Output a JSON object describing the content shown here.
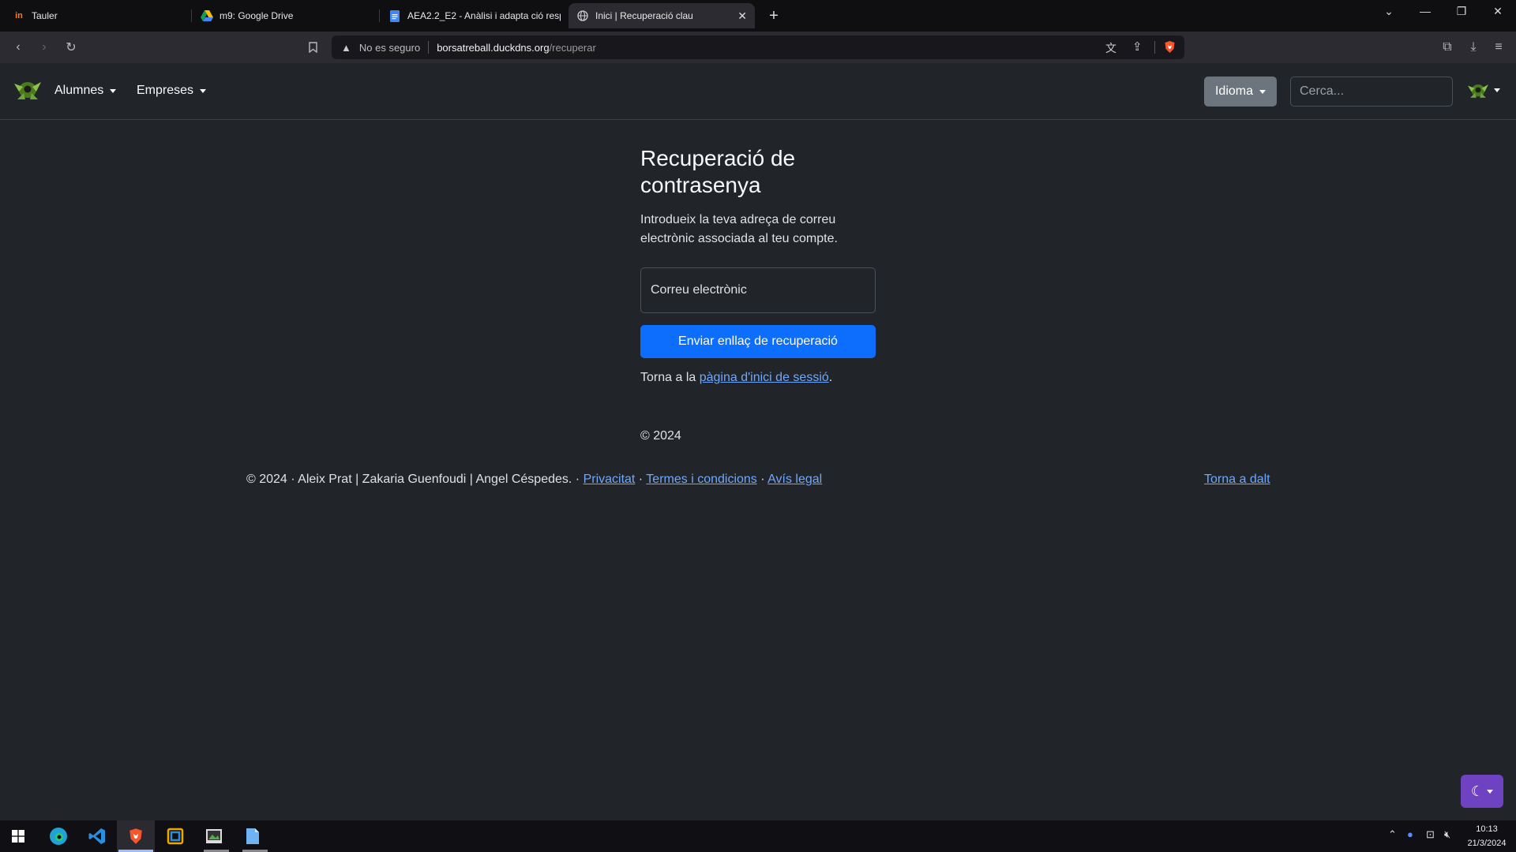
{
  "browser": {
    "tabs": [
      {
        "title": "Tauler",
        "favicon": "in"
      },
      {
        "title": "m9: Google Drive",
        "favicon": "drive"
      },
      {
        "title": "AEA2.2_E2 - Anàlisi i adapta ció resp",
        "favicon": "doc"
      },
      {
        "title": "Inici | Recuperació clau",
        "favicon": "globe",
        "active": true
      }
    ],
    "url_warning": "No es seguro",
    "url_host": "borsatreball.duckdns.org",
    "url_path": "/recuperar"
  },
  "navbar": {
    "alumnes": "Alumnes",
    "empreses": "Empreses",
    "idioma": "Idioma",
    "search_placeholder": "Cerca..."
  },
  "content": {
    "title": "Recuperació de contrasenya",
    "description": "Introdueix la teva adreça de correu electrònic associada al teu compte.",
    "email_placeholder": "Correu electrònic",
    "email_value": "",
    "send_button": "Enviar enllaç de recuperació",
    "back_prefix": "Torna a la ",
    "back_link": "pàgina d'inici de sessió",
    "back_suffix": ".",
    "copyright": "© 2024"
  },
  "footer": {
    "credits": "© 2024 · Aleix Prat | Zakaria Guenfoudi | Angel Céspedes. · ",
    "privacy": "Privacitat",
    "sep1": " · ",
    "terms": "Termes i condicions",
    "sep2": " · ",
    "legal": "Avís legal",
    "back_to_top": "Torna a dalt"
  },
  "taskbar": {
    "time": "10:13",
    "date": "21/3/2024"
  },
  "colors": {
    "page_bg": "#212529",
    "primary": "#0d6efd",
    "link": "#6ea8fe",
    "idioma_bg": "#6c757d",
    "theme_toggle": "#6f42c1"
  }
}
